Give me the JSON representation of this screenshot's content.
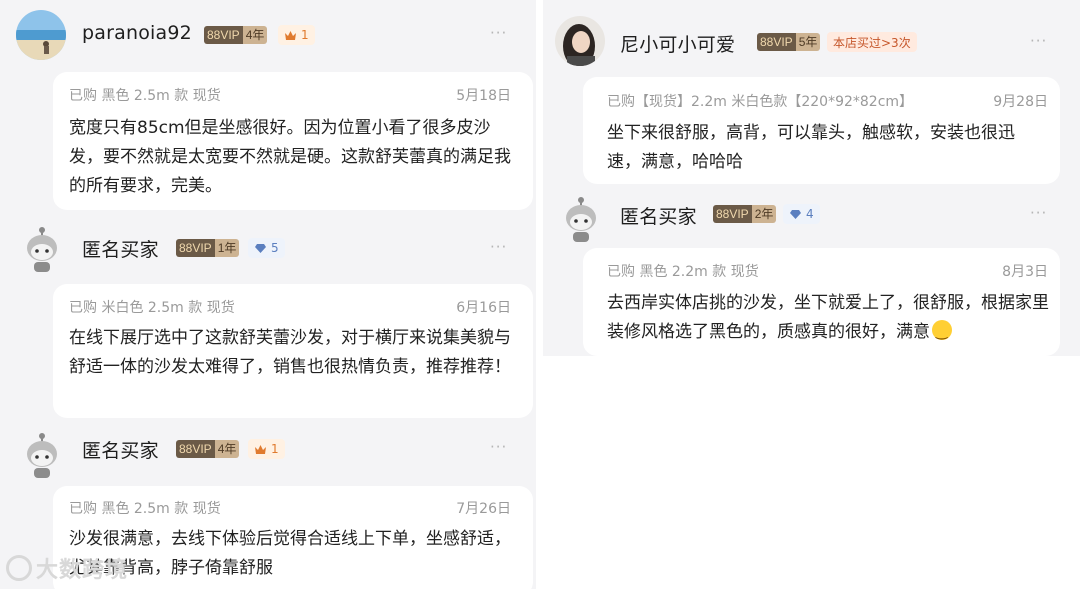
{
  "left_column": {
    "reviews": [
      {
        "username": "paranoia92",
        "vip_label": "88VIP",
        "vip_years": "4年",
        "badge_type": "crown",
        "badge_count": "1",
        "more": "···",
        "meta": "已购  黑色 2.5m 款  现货",
        "date": "5月18日",
        "text": "宽度只有85cm但是坐感很好。因为位置小看了很多皮沙发，要不然就是太宽要不然就是硬。这款舒芙蕾真的满足我的所有要求，完美。"
      },
      {
        "username": "匿名买家",
        "vip_label": "88VIP",
        "vip_years": "1年",
        "badge_type": "diamond",
        "badge_count": "5",
        "more": "···",
        "meta": "已购  米白色 2.5m 款  现货",
        "date": "6月16日",
        "text": "在线下展厅选中了这款舒芙蕾沙发，对于横厅来说集美貌与舒适一体的沙发太难得了，销售也很热情负责，推荐推荐！"
      },
      {
        "username": "匿名买家",
        "vip_label": "88VIP",
        "vip_years": "4年",
        "badge_type": "crown",
        "badge_count": "1",
        "more": "···",
        "meta": "已购  黑色 2.5m 款  现货",
        "date": "7月26日",
        "text": "沙发很满意，去线下体验后觉得合适线上下单，坐感舒适，尤其靠背高，脖子倚靠舒服"
      }
    ]
  },
  "right_column": {
    "reviews": [
      {
        "username": "尼小可小可爱",
        "vip_label": "88VIP",
        "vip_years": "5年",
        "repeat_label": "本店买过>3次",
        "more": "···",
        "meta": "已购【现货】2.2m 米白色款【220*92*82cm】",
        "date": "9月28日",
        "text": "坐下来很舒服，高背，可以靠头，触感软，安装也很迅速，满意，哈哈哈"
      },
      {
        "username": "匿名买家",
        "vip_label": "88VIP",
        "vip_years": "2年",
        "badge_type": "diamond",
        "badge_count": "4",
        "more": "···",
        "meta": "已购  黑色 2.2m 款  现货",
        "date": "8月3日",
        "text": "去西岸实体店挑的沙发，坐下就爱上了，很舒服，根据家里装修风格选了黑色的，质感真的很好，满意"
      }
    ]
  },
  "watermark": "大数跨境",
  "colors": {
    "background": "#f4f4f6",
    "card": "#ffffff",
    "vip_dark": "#6b5a47",
    "vip_light": "#cdb392",
    "crown": "#e07a2e",
    "diamond": "#5b7fbf"
  },
  "icons": [
    "beach-avatar",
    "mascot-avatar",
    "woman-avatar",
    "crown-icon",
    "diamond-icon",
    "more-dots-icon",
    "smile-emoji-icon"
  ]
}
